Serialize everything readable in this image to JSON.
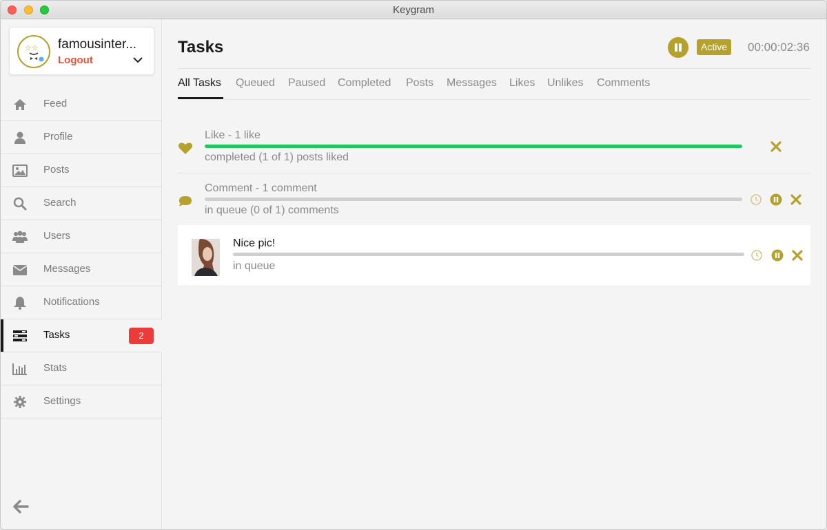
{
  "window": {
    "title": "Keygram"
  },
  "account": {
    "name": "famousinter...",
    "logout": "Logout"
  },
  "sidebar": {
    "items": [
      {
        "label": "Feed",
        "icon": "home-icon"
      },
      {
        "label": "Profile",
        "icon": "user-icon"
      },
      {
        "label": "Posts",
        "icon": "image-icon"
      },
      {
        "label": "Search",
        "icon": "search-icon"
      },
      {
        "label": "Users",
        "icon": "users-icon"
      },
      {
        "label": "Messages",
        "icon": "envelope-icon"
      },
      {
        "label": "Notifications",
        "icon": "bell-icon"
      },
      {
        "label": "Tasks",
        "icon": "tasks-icon",
        "badge": "2",
        "active": true
      },
      {
        "label": "Stats",
        "icon": "bar-chart-icon"
      },
      {
        "label": "Settings",
        "icon": "gear-icon"
      }
    ]
  },
  "header": {
    "title": "Tasks",
    "status": "Active",
    "timer": "00:00:02:36"
  },
  "tabs": [
    {
      "label": "All Tasks",
      "active": true
    },
    {
      "label": "Queued"
    },
    {
      "label": "Paused"
    },
    {
      "label": "Completed"
    },
    {
      "label": "Posts"
    },
    {
      "label": "Messages"
    },
    {
      "label": "Likes"
    },
    {
      "label": "Unlikes"
    },
    {
      "label": "Comments"
    }
  ],
  "tasks": [
    {
      "title": "Like - 1 like",
      "status": "completed (1 of 1) posts liked",
      "progress": 1.0,
      "icon": "heart-icon"
    },
    {
      "title": "Comment - 1 comment",
      "status": "in queue (0 of 1) comments",
      "progress": 0.0,
      "icon": "comment-icon"
    }
  ],
  "subtask": {
    "title": "Nice pic!",
    "status": "in queue",
    "progress": 0.0
  },
  "colors": {
    "accent": "#b5a12c",
    "progress": "#22c55e",
    "badge": "#ec3b3b",
    "logout": "#e8503a"
  }
}
